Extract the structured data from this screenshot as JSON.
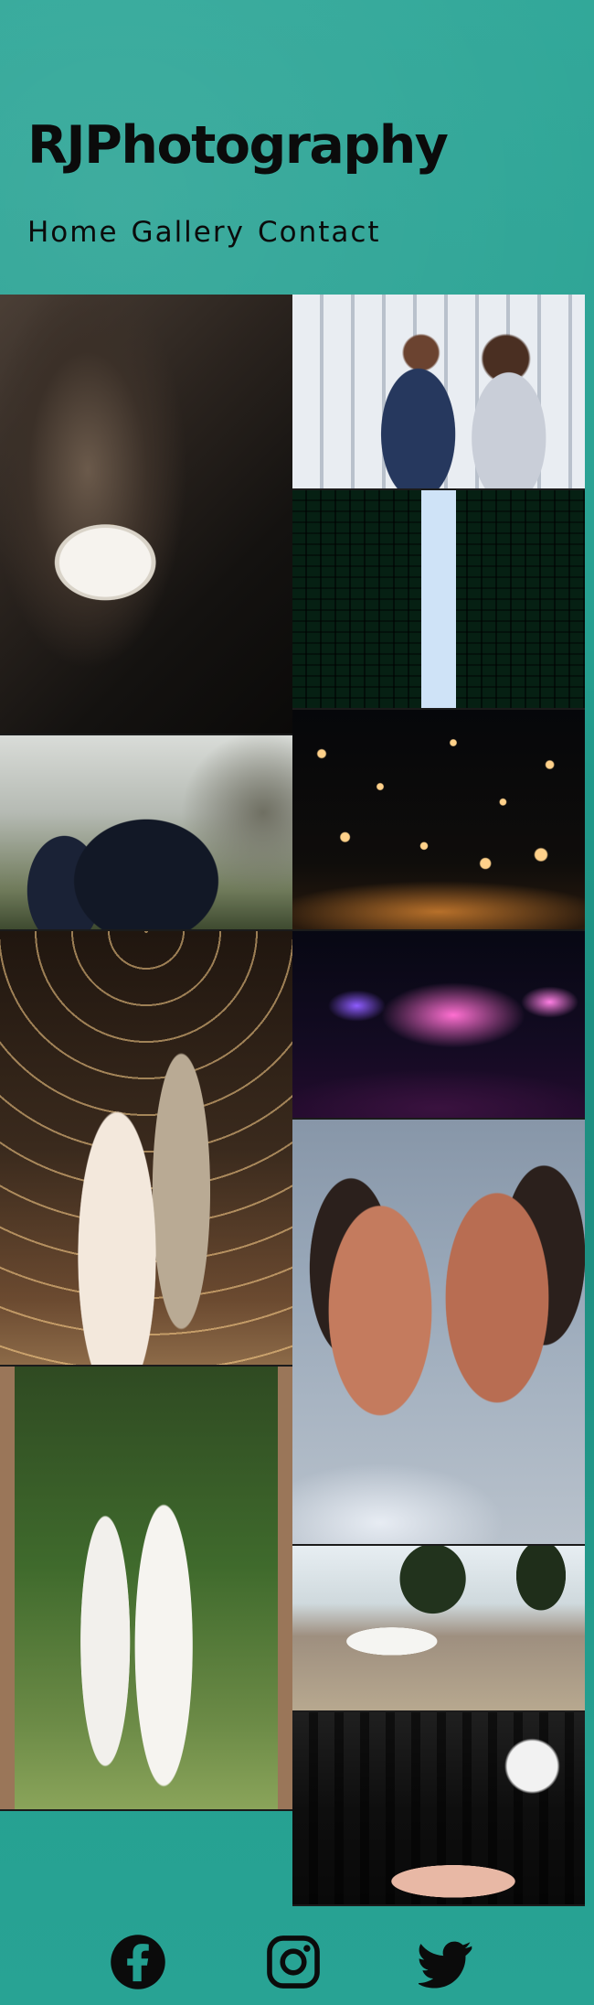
{
  "site": {
    "brand": "RJPhotography",
    "nav": [
      "Home",
      "Gallery",
      "Contact"
    ]
  },
  "gallery": {
    "photos": [
      {
        "name": "photo-wedding-rings",
        "alt": "Wedding rings on lace pillow"
      },
      {
        "name": "photo-business-portrait",
        "alt": "Business portrait of two colleagues"
      },
      {
        "name": "photo-skyscrapers",
        "alt": "Looking up between skyscrapers"
      },
      {
        "name": "photo-groomsmen",
        "alt": "Groomsmen on stone steps"
      },
      {
        "name": "photo-sky-lanterns",
        "alt": "Sky lanterns festival at night"
      },
      {
        "name": "photo-wedding-kiss",
        "alt": "Couple under string lights"
      },
      {
        "name": "photo-concert",
        "alt": "Concert stage with lights"
      },
      {
        "name": "photo-laughing-couple",
        "alt": "Two women laughing"
      },
      {
        "name": "photo-two-brides",
        "alt": "Two brides in garden"
      },
      {
        "name": "photo-car-shoot",
        "alt": "White sports car on road"
      },
      {
        "name": "photo-studio-crew",
        "alt": "Studio crew group photo"
      }
    ]
  },
  "social": {
    "facebook": "Facebook",
    "instagram": "Instagram",
    "twitter": "Twitter"
  },
  "colors": {
    "background": "#23a091",
    "text": "#0b0b0b"
  }
}
